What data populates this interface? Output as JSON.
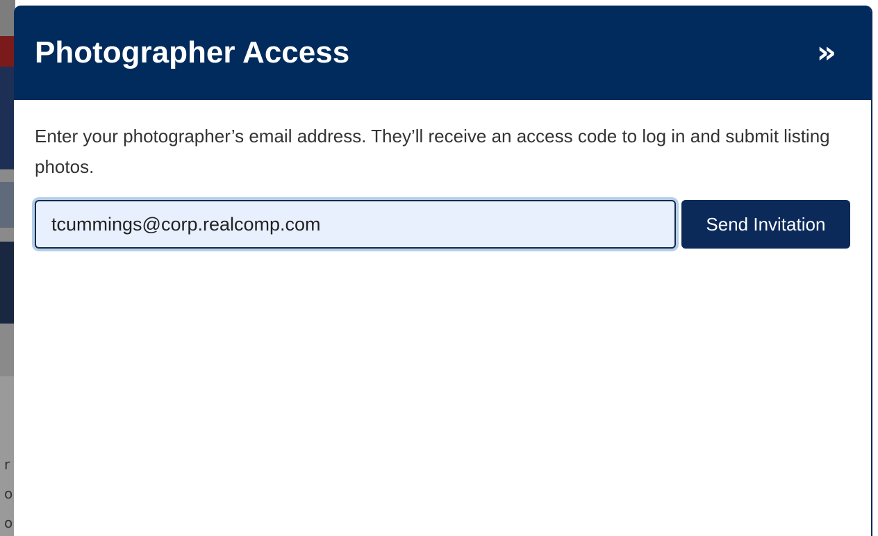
{
  "panel": {
    "title": "Photographer Access",
    "collapse_icon": "»",
    "description": "Enter your photographer’s email address. They’ll receive an access code to log in and submit listing photos.",
    "email_input": {
      "value": "tcummings@corp.realcomp.com",
      "placeholder": ""
    },
    "send_button_label": "Send Invitation"
  },
  "background": {
    "partial_letters": [
      "r",
      "o",
      "o"
    ]
  },
  "colors": {
    "header_bg": "#002b5c",
    "button_bg": "#0b2a5a",
    "input_bg": "#e8f0fe"
  }
}
